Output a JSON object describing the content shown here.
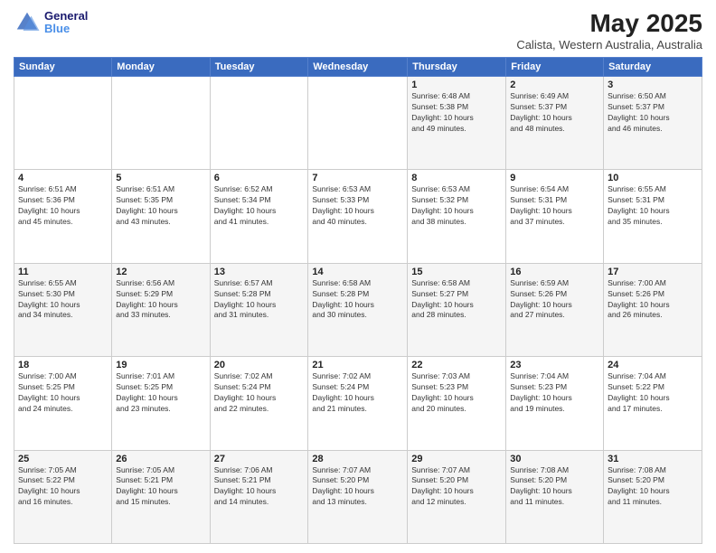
{
  "header": {
    "logo_line1": "General",
    "logo_line2": "Blue",
    "title": "May 2025",
    "subtitle": "Calista, Western Australia, Australia"
  },
  "days_of_week": [
    "Sunday",
    "Monday",
    "Tuesday",
    "Wednesday",
    "Thursday",
    "Friday",
    "Saturday"
  ],
  "weeks": [
    [
      {
        "day": "",
        "info": ""
      },
      {
        "day": "",
        "info": ""
      },
      {
        "day": "",
        "info": ""
      },
      {
        "day": "",
        "info": ""
      },
      {
        "day": "1",
        "info": "Sunrise: 6:48 AM\nSunset: 5:38 PM\nDaylight: 10 hours\nand 49 minutes."
      },
      {
        "day": "2",
        "info": "Sunrise: 6:49 AM\nSunset: 5:37 PM\nDaylight: 10 hours\nand 48 minutes."
      },
      {
        "day": "3",
        "info": "Sunrise: 6:50 AM\nSunset: 5:37 PM\nDaylight: 10 hours\nand 46 minutes."
      }
    ],
    [
      {
        "day": "4",
        "info": "Sunrise: 6:51 AM\nSunset: 5:36 PM\nDaylight: 10 hours\nand 45 minutes."
      },
      {
        "day": "5",
        "info": "Sunrise: 6:51 AM\nSunset: 5:35 PM\nDaylight: 10 hours\nand 43 minutes."
      },
      {
        "day": "6",
        "info": "Sunrise: 6:52 AM\nSunset: 5:34 PM\nDaylight: 10 hours\nand 41 minutes."
      },
      {
        "day": "7",
        "info": "Sunrise: 6:53 AM\nSunset: 5:33 PM\nDaylight: 10 hours\nand 40 minutes."
      },
      {
        "day": "8",
        "info": "Sunrise: 6:53 AM\nSunset: 5:32 PM\nDaylight: 10 hours\nand 38 minutes."
      },
      {
        "day": "9",
        "info": "Sunrise: 6:54 AM\nSunset: 5:31 PM\nDaylight: 10 hours\nand 37 minutes."
      },
      {
        "day": "10",
        "info": "Sunrise: 6:55 AM\nSunset: 5:31 PM\nDaylight: 10 hours\nand 35 minutes."
      }
    ],
    [
      {
        "day": "11",
        "info": "Sunrise: 6:55 AM\nSunset: 5:30 PM\nDaylight: 10 hours\nand 34 minutes."
      },
      {
        "day": "12",
        "info": "Sunrise: 6:56 AM\nSunset: 5:29 PM\nDaylight: 10 hours\nand 33 minutes."
      },
      {
        "day": "13",
        "info": "Sunrise: 6:57 AM\nSunset: 5:28 PM\nDaylight: 10 hours\nand 31 minutes."
      },
      {
        "day": "14",
        "info": "Sunrise: 6:58 AM\nSunset: 5:28 PM\nDaylight: 10 hours\nand 30 minutes."
      },
      {
        "day": "15",
        "info": "Sunrise: 6:58 AM\nSunset: 5:27 PM\nDaylight: 10 hours\nand 28 minutes."
      },
      {
        "day": "16",
        "info": "Sunrise: 6:59 AM\nSunset: 5:26 PM\nDaylight: 10 hours\nand 27 minutes."
      },
      {
        "day": "17",
        "info": "Sunrise: 7:00 AM\nSunset: 5:26 PM\nDaylight: 10 hours\nand 26 minutes."
      }
    ],
    [
      {
        "day": "18",
        "info": "Sunrise: 7:00 AM\nSunset: 5:25 PM\nDaylight: 10 hours\nand 24 minutes."
      },
      {
        "day": "19",
        "info": "Sunrise: 7:01 AM\nSunset: 5:25 PM\nDaylight: 10 hours\nand 23 minutes."
      },
      {
        "day": "20",
        "info": "Sunrise: 7:02 AM\nSunset: 5:24 PM\nDaylight: 10 hours\nand 22 minutes."
      },
      {
        "day": "21",
        "info": "Sunrise: 7:02 AM\nSunset: 5:24 PM\nDaylight: 10 hours\nand 21 minutes."
      },
      {
        "day": "22",
        "info": "Sunrise: 7:03 AM\nSunset: 5:23 PM\nDaylight: 10 hours\nand 20 minutes."
      },
      {
        "day": "23",
        "info": "Sunrise: 7:04 AM\nSunset: 5:23 PM\nDaylight: 10 hours\nand 19 minutes."
      },
      {
        "day": "24",
        "info": "Sunrise: 7:04 AM\nSunset: 5:22 PM\nDaylight: 10 hours\nand 17 minutes."
      }
    ],
    [
      {
        "day": "25",
        "info": "Sunrise: 7:05 AM\nSunset: 5:22 PM\nDaylight: 10 hours\nand 16 minutes."
      },
      {
        "day": "26",
        "info": "Sunrise: 7:05 AM\nSunset: 5:21 PM\nDaylight: 10 hours\nand 15 minutes."
      },
      {
        "day": "27",
        "info": "Sunrise: 7:06 AM\nSunset: 5:21 PM\nDaylight: 10 hours\nand 14 minutes."
      },
      {
        "day": "28",
        "info": "Sunrise: 7:07 AM\nSunset: 5:20 PM\nDaylight: 10 hours\nand 13 minutes."
      },
      {
        "day": "29",
        "info": "Sunrise: 7:07 AM\nSunset: 5:20 PM\nDaylight: 10 hours\nand 12 minutes."
      },
      {
        "day": "30",
        "info": "Sunrise: 7:08 AM\nSunset: 5:20 PM\nDaylight: 10 hours\nand 11 minutes."
      },
      {
        "day": "31",
        "info": "Sunrise: 7:08 AM\nSunset: 5:20 PM\nDaylight: 10 hours\nand 11 minutes."
      }
    ]
  ]
}
